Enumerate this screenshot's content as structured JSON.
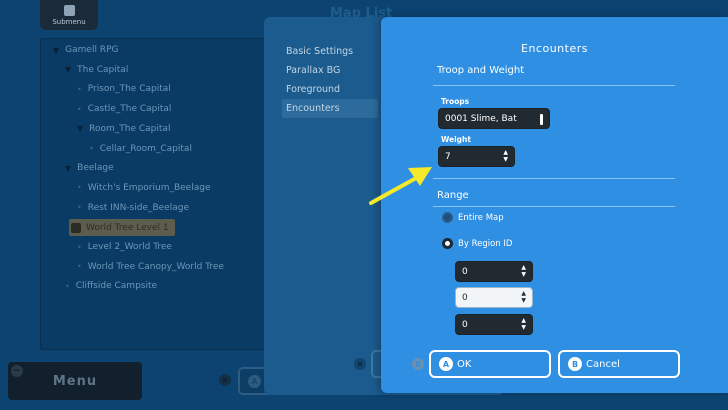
{
  "background": {
    "submenu_label": "Submenu",
    "window_title": "Map List",
    "tree": [
      {
        "label": "Gamell RPG",
        "type": "folder",
        "level": 0,
        "selected": false
      },
      {
        "label": "The Capital",
        "type": "folder",
        "level": 1,
        "selected": false
      },
      {
        "label": "Prison_The Capital",
        "type": "map",
        "level": 2,
        "selected": false
      },
      {
        "label": "Castle_The Capital",
        "type": "map",
        "level": 2,
        "selected": false
      },
      {
        "label": "Room_The Capital",
        "type": "folder",
        "level": 2,
        "selected": false
      },
      {
        "label": "Cellar_Room_Capital",
        "type": "map",
        "level": 3,
        "selected": false
      },
      {
        "label": "Beelage",
        "type": "folder",
        "level": 1,
        "selected": false
      },
      {
        "label": "Witch's Emporium_Beelage",
        "type": "map",
        "level": 2,
        "selected": false
      },
      {
        "label": "Rest INN-side_Beelage",
        "type": "map",
        "level": 2,
        "selected": false
      },
      {
        "label": "World Tree Level 1",
        "type": "map",
        "level": 1,
        "selected": true
      },
      {
        "label": "Level 2_World Tree",
        "type": "map",
        "level": 2,
        "selected": false
      },
      {
        "label": "World Tree Canopy_World Tree",
        "type": "map",
        "level": 2,
        "selected": false
      },
      {
        "label": "Cliffside Campsite",
        "type": "map",
        "level": 1,
        "selected": false
      }
    ],
    "menu_label": "Menu"
  },
  "settings_nav": {
    "items": [
      "Basic Settings",
      "Parallax BG",
      "Foreground",
      "Encounters"
    ],
    "active_index": 3
  },
  "encounters": {
    "title": "Encounters",
    "troop_section": "Troop and Weight",
    "troops_label": "Troops",
    "troops_value": "0001 Slime, Bat",
    "weight_label": "Weight",
    "weight_value": "7",
    "range_section": "Range",
    "range_options": [
      {
        "label": "Entire Map",
        "selected": false
      },
      {
        "label": "By Region ID",
        "selected": true
      }
    ],
    "region_ids": [
      "0",
      "0",
      "0"
    ],
    "focused_region_index": 1,
    "ok_label": "OK",
    "cancel_label": "Cancel",
    "ok_key": "A",
    "cancel_key": "B",
    "close_key": "X"
  },
  "colors": {
    "dialog": "#2f8fe3",
    "field": "#222a31",
    "annotation_arrow": "#f4ea2a"
  }
}
